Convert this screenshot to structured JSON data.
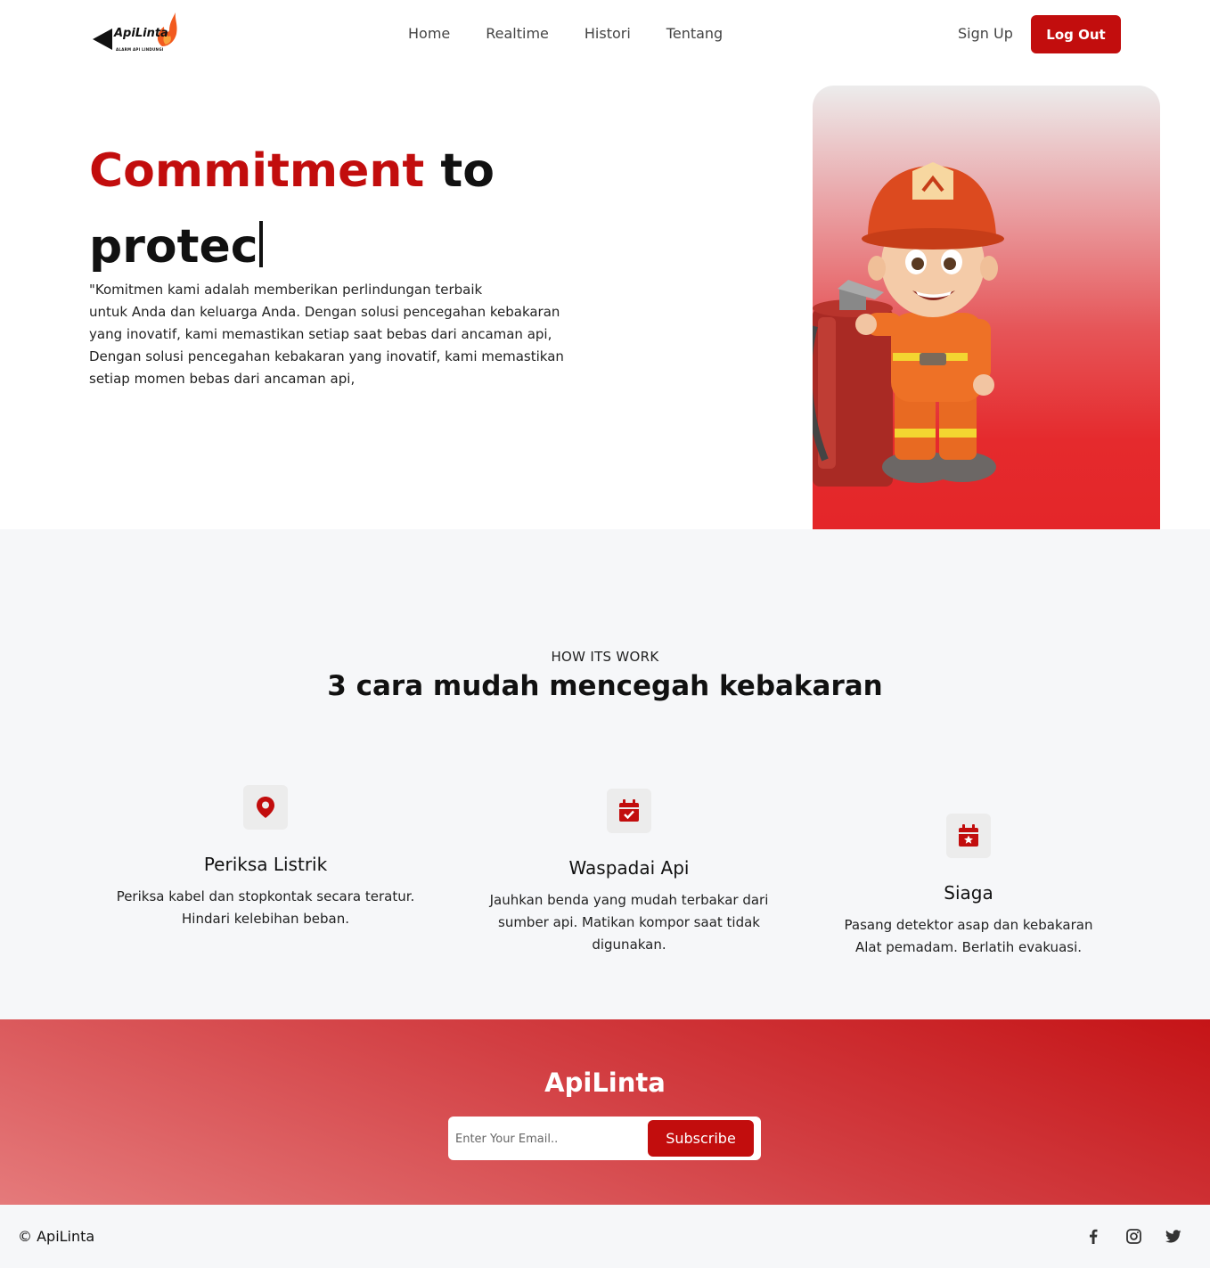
{
  "nav": {
    "logo_text": "ApiLinta",
    "logo_tagline": "ALARM API LINDUNGI",
    "links": [
      "Home",
      "Realtime",
      "Histori",
      "Tentang"
    ],
    "signup_label": "Sign Up",
    "logout_label": "Log Out"
  },
  "hero": {
    "title_accent": "Commitment",
    "title_rest": " to",
    "title_line2": "protec",
    "description": "\"Komitmen kami adalah memberikan perlindungan terbaik\nuntuk Anda dan keluarga Anda. Dengan solusi pencegahan kebakaran\nyang inovatif, kami memastikan setiap saat bebas dari ancaman api,\nDengan solusi pencegahan kebakaran yang inovatif, kami memastikan\nsetiap momen bebas dari ancaman api,"
  },
  "how": {
    "eyebrow": "HOW ITS WORK",
    "heading": "3 cara mudah mencegah kebakaran",
    "steps": [
      {
        "icon": "map-pin-icon",
        "title": "Periksa Listrik",
        "desc": "Periksa kabel dan stopkontak secara teratur.\nHindari kelebihan beban."
      },
      {
        "icon": "calendar-check-icon",
        "title": "Waspadai Api",
        "desc": "Jauhkan benda yang mudah terbakar dari\nsumber api. Matikan kompor saat tidak\ndigunakan."
      },
      {
        "icon": "calendar-star-icon",
        "title": "Siaga",
        "desc": "Pasang detektor asap dan kebakaran\nAlat pemadam. Berlatih evakuasi."
      }
    ]
  },
  "subscribe": {
    "brand": "ApiLinta",
    "email_placeholder": "Enter Your Email..",
    "button_label": "Subscribe"
  },
  "footer": {
    "copyright": "© ApiLinta",
    "social": [
      "facebook-icon",
      "instagram-icon",
      "twitter-icon"
    ]
  },
  "colors": {
    "accent": "#c20d0d",
    "section_bg": "#f6f7f9"
  }
}
